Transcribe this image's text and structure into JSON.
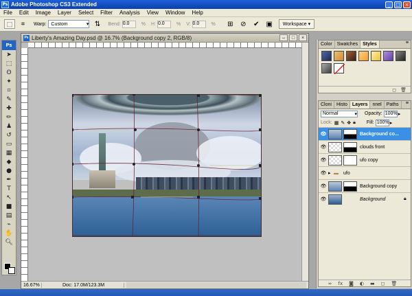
{
  "app": {
    "title": "Adobe Photoshop CS3 Extended",
    "logo": "Ps"
  },
  "menu": [
    "File",
    "Edit",
    "Image",
    "Layer",
    "Select",
    "Filter",
    "Analysis",
    "View",
    "Window",
    "Help"
  ],
  "options": {
    "warp_label": "Warp:",
    "warp_value": "Custom",
    "bend_label": "Bend:",
    "bend_value": "0.0",
    "bend_unit": "%",
    "h_label": "H:",
    "h_value": "0.0",
    "h_unit": "%",
    "v_label": "V:",
    "v_value": "0.0",
    "v_unit": "%",
    "workspace_label": "Workspace"
  },
  "document": {
    "title": "Liberty's Amazing Day.psd @ 16.7% (Background copy 2, RGB/8)",
    "zoom": "16.67%",
    "doc_size": "Doc: 17.0M/123.3M"
  },
  "panels": {
    "top_tabs": [
      "Color",
      "Swatches",
      "Styles"
    ],
    "styles": [
      "#1f2a4f",
      "#c98a3a",
      "#3a1e18",
      "#f0a030",
      "#e8c040",
      "#6040a0",
      "#222222",
      "#404040",
      "#e02020"
    ],
    "bottom_tabs": [
      "Cloni",
      "Histo",
      "Layers",
      "nnel",
      "Paths"
    ],
    "blend_mode": "Normal",
    "opacity_label": "Opacity:",
    "opacity_value": "100%",
    "lock_label": "Lock:",
    "fill_label": "Fill:",
    "fill_value": "100%",
    "layers": [
      {
        "name": "Background co...",
        "selected": true
      },
      {
        "name": "clouds front",
        "selected": false
      },
      {
        "name": "ufo copy",
        "selected": false
      },
      {
        "name": "ufo",
        "selected": false,
        "group": true
      },
      {
        "name": "Background copy",
        "selected": false
      },
      {
        "name": "Background",
        "selected": false,
        "locked": true
      }
    ]
  }
}
